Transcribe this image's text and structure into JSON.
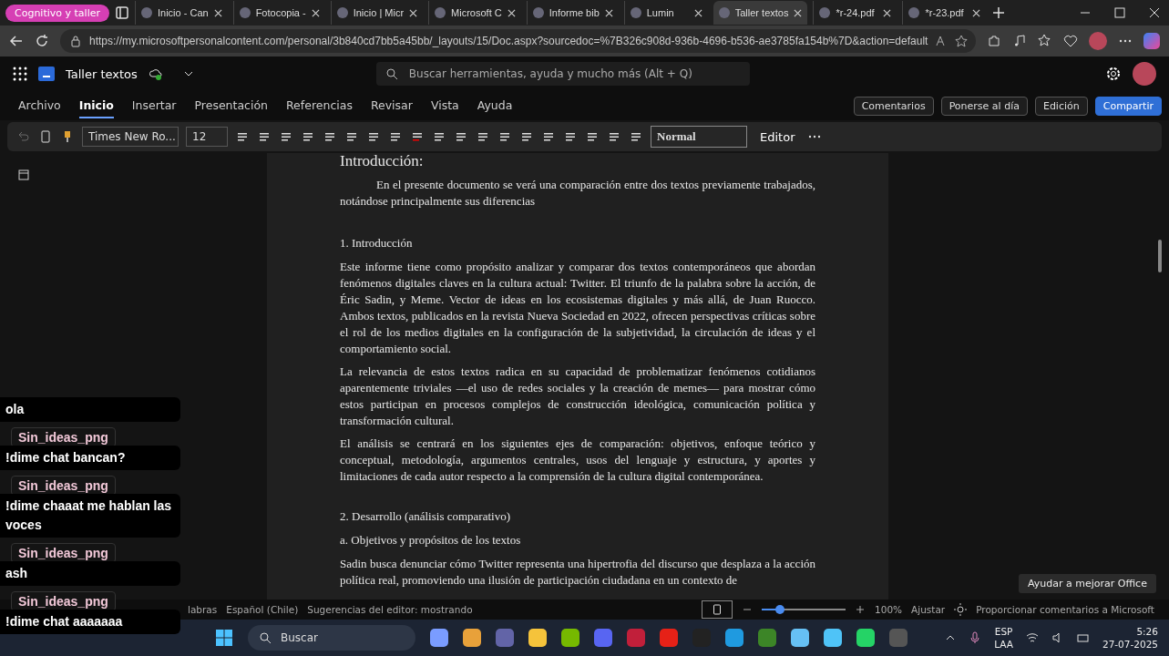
{
  "browser": {
    "profile": "Cognitivo y taller",
    "tabs": [
      {
        "label": "Inicio - Can",
        "selected": false
      },
      {
        "label": "Fotocopia -",
        "selected": false
      },
      {
        "label": "Inicio | Micr",
        "selected": false
      },
      {
        "label": "Microsoft C",
        "selected": false
      },
      {
        "label": "Informe bib",
        "selected": false
      },
      {
        "label": "Lumin",
        "selected": false
      },
      {
        "label": "Taller textos",
        "selected": true
      },
      {
        "label": "*r-24.pdf",
        "selected": false
      },
      {
        "label": "*r-23.pdf",
        "selected": false
      }
    ],
    "url": "https://my.microsoftpersonalcontent.com/personal/3b840cd7bb5a45bb/_layouts/15/Doc.aspx?sourcedoc=%7B326c908d-936b-4696-b536-ae3785fa154b%7D&action=default"
  },
  "app": {
    "title": "Taller textos",
    "search": {
      "placeholder": "Buscar herramientas, ayuda y mucho más (Alt + Q)"
    },
    "menu": [
      {
        "label": "Archivo",
        "selected": false
      },
      {
        "label": "Inicio",
        "selected": true
      },
      {
        "label": "Insertar",
        "selected": false
      },
      {
        "label": "Presentación",
        "selected": false
      },
      {
        "label": "Referencias",
        "selected": false
      },
      {
        "label": "Revisar",
        "selected": false
      },
      {
        "label": "Vista",
        "selected": false
      },
      {
        "label": "Ayuda",
        "selected": false
      }
    ],
    "actions": {
      "comments": "Comentarios",
      "catch_up": "Ponerse al día",
      "editing": "Edición",
      "share": "Compartir"
    },
    "ribbon": {
      "font": "Times New Ro...",
      "size": "12",
      "style": "Normal",
      "editor": "Editor"
    }
  },
  "document": [
    {
      "kind": "title",
      "text": "Introducción:"
    },
    {
      "kind": "indent",
      "text": "En el presente documento se verá una comparación entre dos textos previamente trabajados, notándose principalmente sus diferencias"
    },
    {
      "kind": "heading",
      "text": "1. Introducción"
    },
    {
      "kind": "body",
      "text": "Este informe tiene como propósito analizar y comparar dos textos contemporáneos que abordan fenómenos digitales claves en la cultura actual: Twitter. El triunfo de la palabra sobre la acción, de Éric Sadin, y Meme. Vector de ideas en los ecosistemas digitales y más allá, de Juan Ruocco. Ambos textos, publicados en la revista Nueva Sociedad en 2022, ofrecen perspectivas críticas sobre el rol de los medios digitales en la configuración de la subjetividad, la circulación de ideas y el comportamiento social."
    },
    {
      "kind": "body",
      "text": "La relevancia de estos textos radica en su capacidad de problematizar fenómenos cotidianos aparentemente triviales —el uso de redes sociales y la creación de memes— para mostrar cómo estos participan en procesos complejos de construcción ideológica, comunicación política y transformación cultural."
    },
    {
      "kind": "body",
      "text": "El análisis se centrará en los siguientes ejes de comparación: objetivos, enfoque teórico y conceptual, metodología, argumentos centrales, usos del lenguaje y estructura, y aportes y limitaciones de cada autor respecto a la comprensión de la cultura digital contemporánea."
    },
    {
      "kind": "section",
      "text": "2. Desarrollo (análisis comparativo)"
    },
    {
      "kind": "heading",
      "text": "a. Objetivos y propósitos de los textos"
    },
    {
      "kind": "body",
      "text": "Sadin busca denunciar cómo Twitter representa una hipertrofia del discurso que desplaza a la acción política real, promoviendo una ilusión de participación ciudadana en un contexto de"
    }
  ],
  "status": {
    "words": "labras",
    "language": "Español (Chile)",
    "suggestions": "Sugerencias del editor: mostrando",
    "zoom": {
      "level": 0.22,
      "reading": "100%"
    },
    "fit": "Ajustar",
    "feedback": "Proporcionar comentarios a Microsoft",
    "tooltip": "Ayudar a mejorar Office"
  },
  "chat": [
    {
      "text": "ola"
    },
    {
      "user": "Sin_ideas_png",
      "text": "!dime chat bancan?"
    },
    {
      "user": "Sin_ideas_png",
      "text": "!dime chaaat me hablan las voces"
    },
    {
      "user": "Sin_ideas_png",
      "text": "ash"
    },
    {
      "user": "Sin_ideas_png",
      "text": "!dime chat aaaaaaa"
    }
  ],
  "taskbar": {
    "search": "Buscar",
    "lang_top": "ESP",
    "lang_bottom": "LAA",
    "time": "5:26",
    "date": "27-07-2025"
  }
}
